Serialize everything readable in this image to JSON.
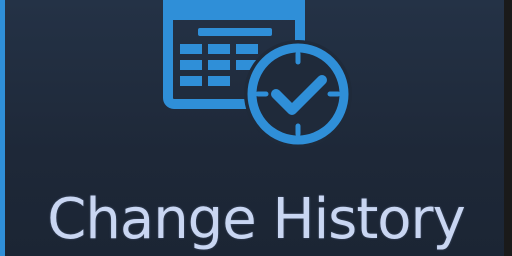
{
  "tile": {
    "label": "Change History",
    "icon": "calendar-clock-check-icon",
    "colors": {
      "background": "#1f2a3a",
      "accent": "#2f8fd8",
      "icon": "#2f8fd8",
      "text": "#c9d6f2"
    }
  }
}
